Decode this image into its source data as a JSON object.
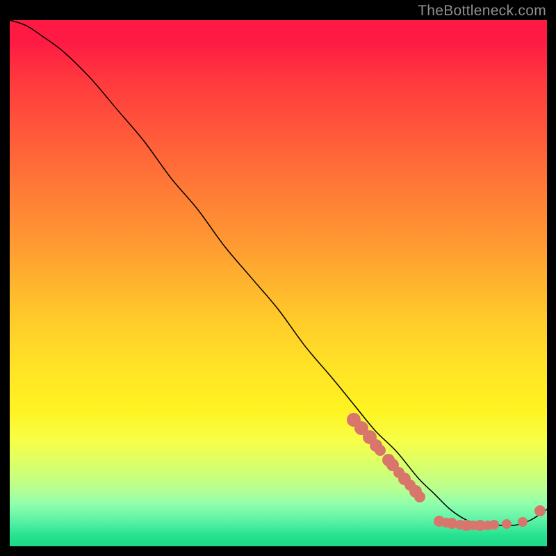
{
  "watermark": "TheBottleneck.com",
  "chart_data": {
    "type": "line",
    "title": "",
    "xlabel": "",
    "ylabel": "",
    "xlim": [
      0,
      100
    ],
    "ylim": [
      0,
      100
    ],
    "series": [
      {
        "name": "curve",
        "x": [
          0,
          3,
          6,
          10,
          15,
          20,
          25,
          30,
          35,
          40,
          45,
          50,
          55,
          60,
          64,
          68,
          72,
          76,
          79,
          82,
          85,
          88,
          91,
          94,
          97,
          100
        ],
        "y": [
          100,
          99,
          97,
          94,
          89,
          83,
          77,
          70,
          64,
          57,
          51,
          45,
          38,
          32,
          27,
          22,
          18,
          13,
          10,
          7,
          5,
          4,
          4,
          4,
          5,
          7
        ]
      }
    ],
    "dots_cluster_line": [
      {
        "x": 64.0,
        "y": 24.0,
        "r": 10
      },
      {
        "x": 65.5,
        "y": 22.5,
        "r": 10
      },
      {
        "x": 67.0,
        "y": 20.7,
        "r": 10
      },
      {
        "x": 68.2,
        "y": 19.2,
        "r": 9
      },
      {
        "x": 69.0,
        "y": 18.2,
        "r": 8
      },
      {
        "x": 70.5,
        "y": 16.4,
        "r": 9
      },
      {
        "x": 71.3,
        "y": 15.4,
        "r": 9
      },
      {
        "x": 72.5,
        "y": 14.0,
        "r": 8
      },
      {
        "x": 73.5,
        "y": 12.8,
        "r": 9
      },
      {
        "x": 74.5,
        "y": 11.6,
        "r": 8
      },
      {
        "x": 75.5,
        "y": 10.4,
        "r": 9
      },
      {
        "x": 76.3,
        "y": 9.4,
        "r": 8
      }
    ],
    "dots_bottom": [
      {
        "x": 80.0,
        "y": 4.8,
        "r": 8
      },
      {
        "x": 81.2,
        "y": 4.5,
        "r": 7
      },
      {
        "x": 82.3,
        "y": 4.3,
        "r": 8
      },
      {
        "x": 83.8,
        "y": 4.1,
        "r": 7
      },
      {
        "x": 85.0,
        "y": 4.0,
        "r": 8
      },
      {
        "x": 86.3,
        "y": 4.0,
        "r": 7
      },
      {
        "x": 87.6,
        "y": 4.0,
        "r": 8
      },
      {
        "x": 89.0,
        "y": 4.0,
        "r": 7
      },
      {
        "x": 90.2,
        "y": 4.1,
        "r": 7
      },
      {
        "x": 92.5,
        "y": 4.2,
        "r": 7
      },
      {
        "x": 95.5,
        "y": 4.6,
        "r": 7
      },
      {
        "x": 98.7,
        "y": 6.8,
        "r": 8
      }
    ]
  }
}
